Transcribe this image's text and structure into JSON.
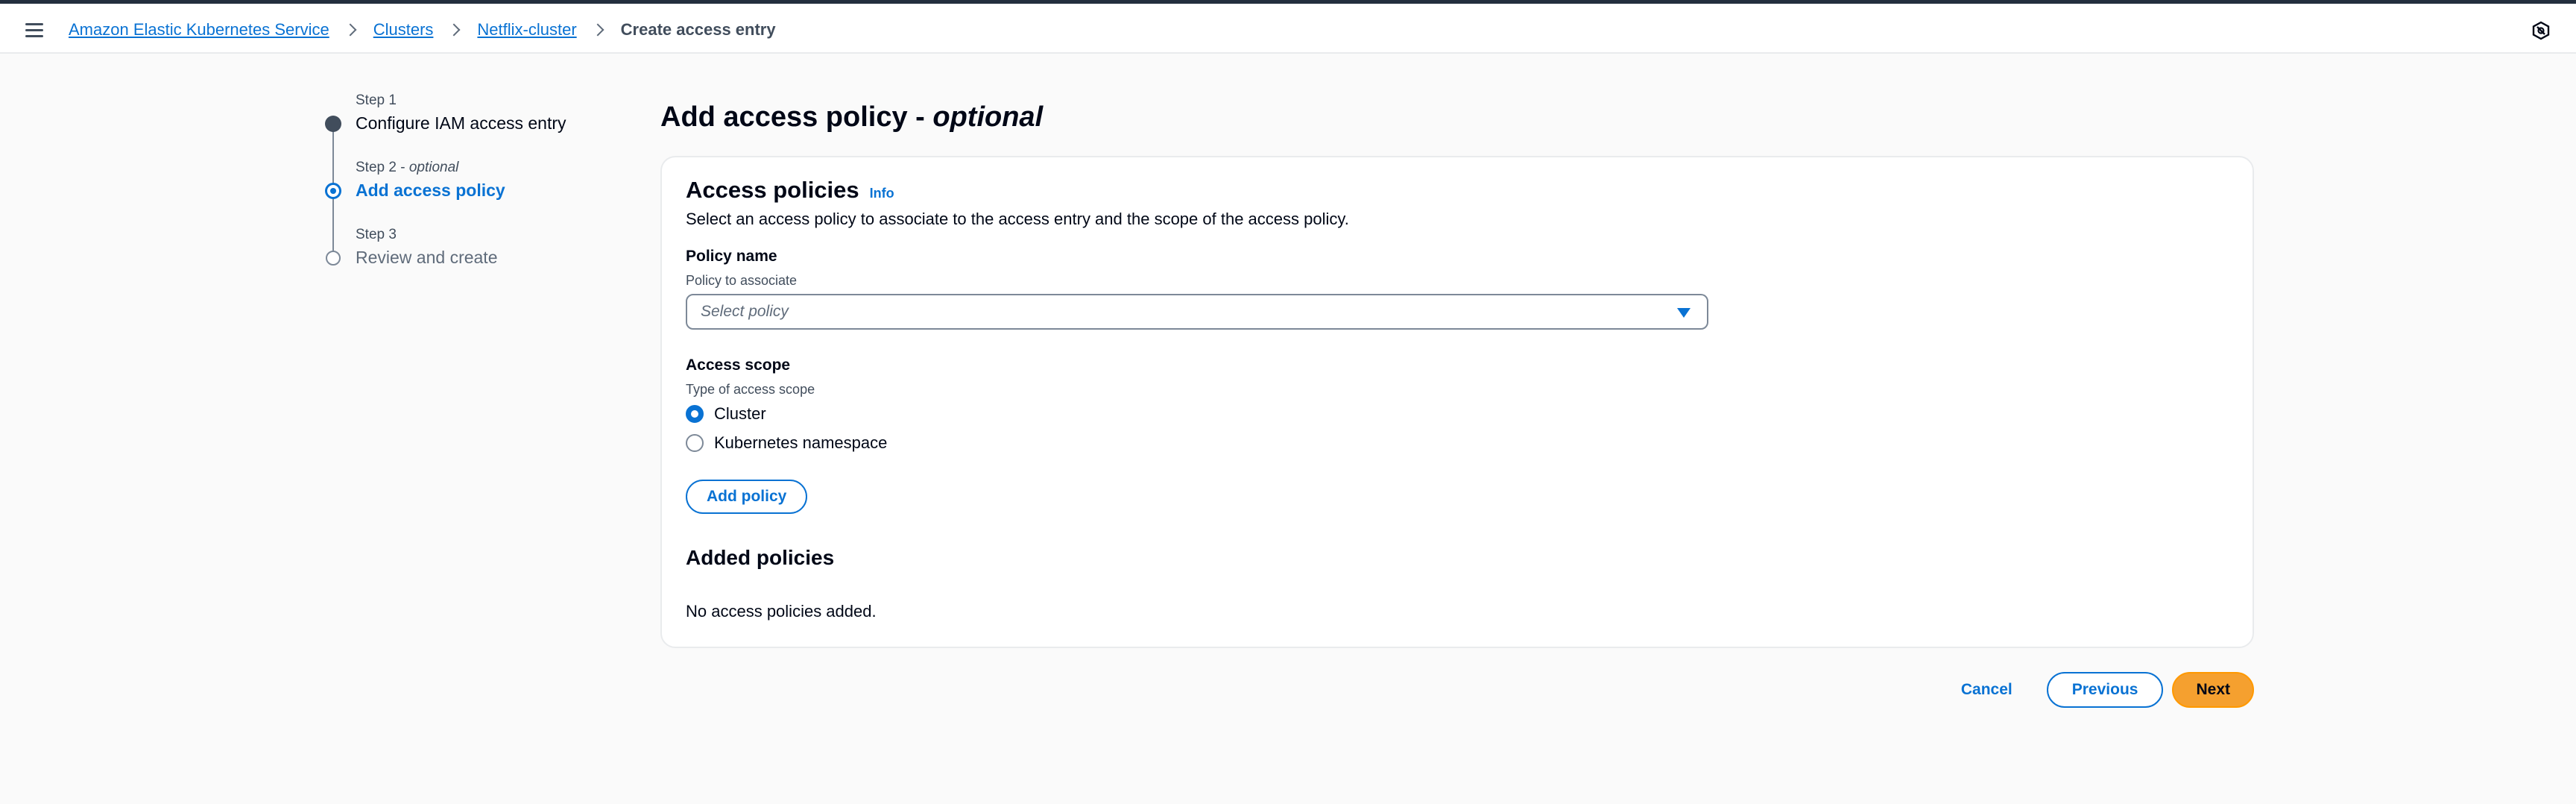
{
  "header": {
    "breadcrumbs": [
      "Amazon Elastic Kubernetes Service",
      "Clusters",
      "Netflix-cluster",
      "Create access entry"
    ]
  },
  "wizard": {
    "steps": [
      {
        "small": "Step 1",
        "optional": "",
        "title": "Configure IAM access entry",
        "state": "completed"
      },
      {
        "small": "Step 2 - ",
        "optional": "optional",
        "title": "Add access policy",
        "state": "active"
      },
      {
        "small": "Step 3",
        "optional": "",
        "title": "Review and create",
        "state": "upcoming"
      }
    ]
  },
  "page": {
    "title": "Add access policy - ",
    "title_optional": "optional"
  },
  "access_policies": {
    "title": "Access policies",
    "info_link": "Info",
    "description": "Select an access policy to associate to the access entry and the scope of the access policy.",
    "policy_name_label": "Policy name",
    "policy_name_desc": "Policy to associate",
    "policy_select_placeholder": "Select policy",
    "access_scope_label": "Access scope",
    "access_scope_desc": "Type of access scope",
    "scope_options": [
      "Cluster",
      "Kubernetes namespace"
    ],
    "scope_selected": "Cluster",
    "add_policy_button": "Add policy",
    "added_heading": "Added policies",
    "empty_text": "No access policies added."
  },
  "actions": {
    "cancel": "Cancel",
    "previous": "Previous",
    "next": "Next"
  },
  "colors": {
    "link": "#0972d3",
    "primary_button": "#f5a02f",
    "text": "#000716",
    "background": "#fafafa"
  }
}
